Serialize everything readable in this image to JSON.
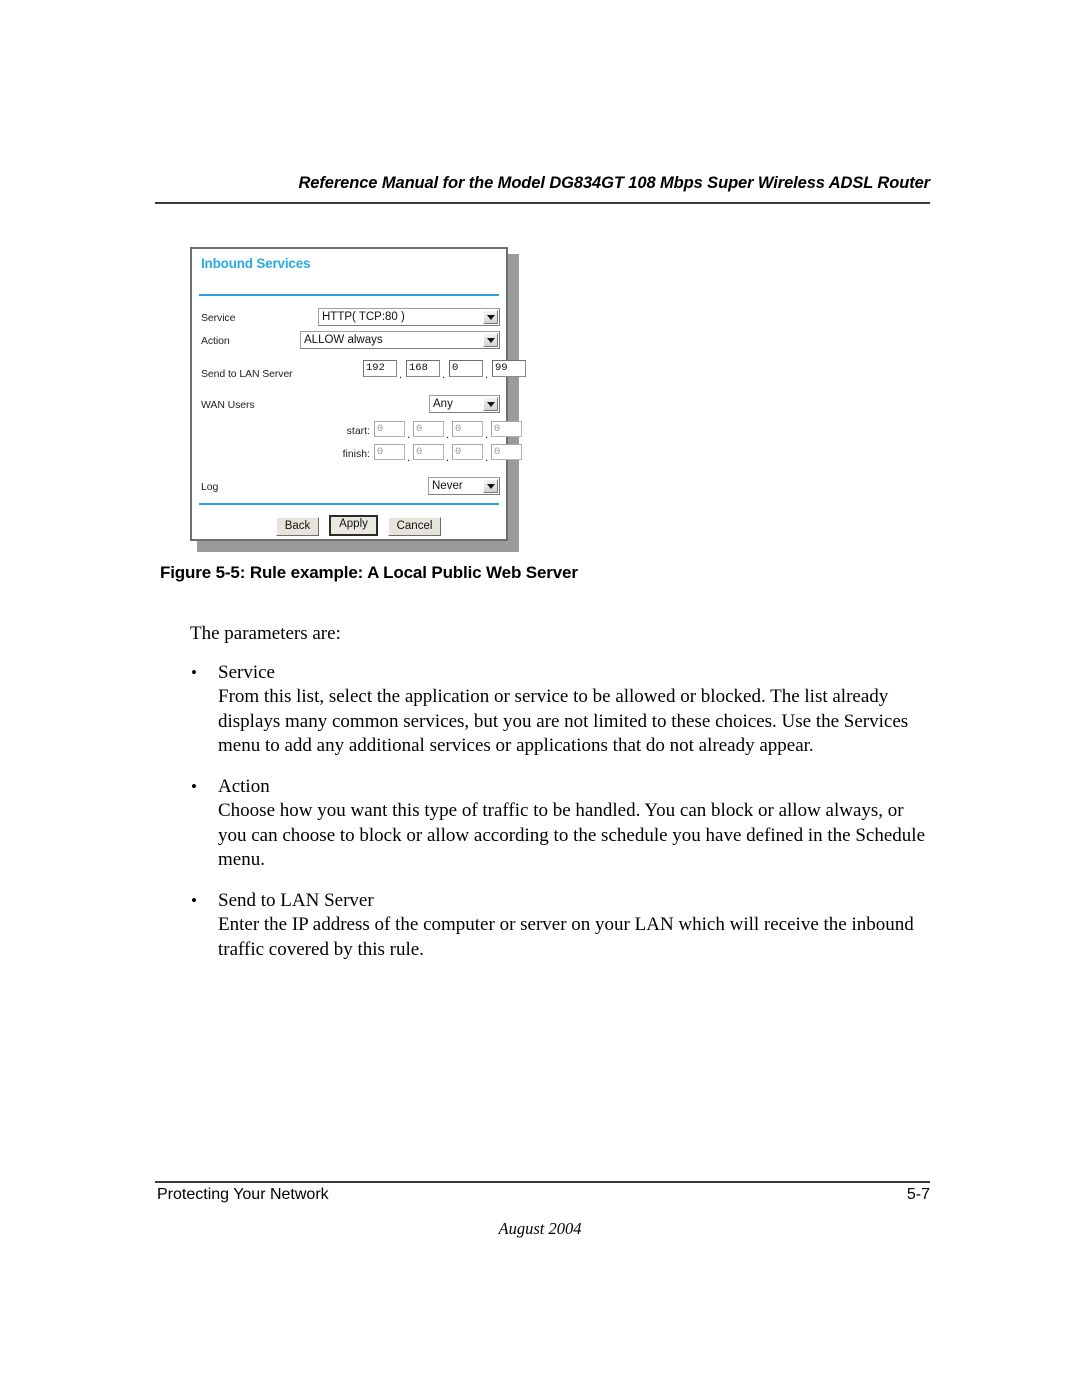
{
  "header": {
    "running_title": "Reference Manual for the Model DG834GT 108 Mbps Super Wireless ADSL Router"
  },
  "figure": {
    "caption": "Figure 5-5:  Rule example: A Local Public Web Server",
    "screenshot": {
      "panel_title": "Inbound Services",
      "accent_color": "#29abe2",
      "fields": {
        "service": {
          "label": "Service",
          "control": "select",
          "value": "HTTP( TCP:80 )"
        },
        "action": {
          "label": "Action",
          "control": "select",
          "value": "ALLOW always"
        },
        "send_to_lan_server": {
          "label": "Send to LAN Server",
          "control": "ip-octets",
          "octets": [
            "192",
            "168",
            "0",
            "99"
          ],
          "separator": "."
        },
        "wan_users": {
          "label": "WAN Users",
          "control": "select",
          "value": "Any"
        },
        "start": {
          "label": "start:",
          "control": "ip-octets",
          "disabled": true,
          "octets": [
            "0",
            "0",
            "0",
            "0"
          ],
          "separator": "."
        },
        "finish": {
          "label": "finish:",
          "control": "ip-octets",
          "disabled": true,
          "octets": [
            "0",
            "0",
            "0",
            "0"
          ],
          "separator": "."
        },
        "log": {
          "label": "Log",
          "control": "select",
          "value": "Never"
        }
      },
      "buttons": {
        "back": "Back",
        "apply": "Apply",
        "cancel": "Cancel",
        "focused": "Apply"
      }
    }
  },
  "body": {
    "intro": "The parameters are:",
    "bullet_char": "•",
    "items": [
      {
        "term": "Service",
        "text": "From this list, select the application or service to be allowed or blocked. The list already displays many common services, but you are not limited to these choices. Use the Services menu to add any additional services or applications that do not already appear."
      },
      {
        "term": "Action",
        "text": "Choose how you want this type of traffic to be handled. You can block or allow always, or you can choose to block or allow according to the schedule you have defined in the Schedule menu."
      },
      {
        "term": "Send to LAN Server",
        "text": "Enter the IP address of the computer or server on your LAN which will receive the inbound traffic covered by this rule."
      }
    ]
  },
  "footer": {
    "section": "Protecting Your Network",
    "page_number": "5-7",
    "date": "August 2004"
  }
}
